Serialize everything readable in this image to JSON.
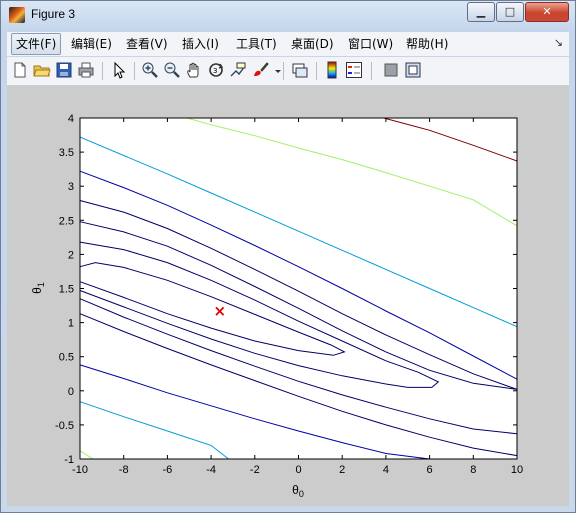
{
  "window": {
    "title": "Figure 3",
    "buttons": {
      "minimize": "▁",
      "maximize": "□",
      "close": "✕"
    }
  },
  "menu": [
    {
      "name": "menu-file",
      "label": "文件(F)",
      "active": true
    },
    {
      "name": "menu-edit",
      "label": "编辑(E)"
    },
    {
      "name": "menu-view",
      "label": "查看(V)"
    },
    {
      "name": "menu-insert",
      "label": "插入(I)"
    },
    {
      "name": "menu-tools",
      "label": "工具(T)"
    },
    {
      "name": "menu-desktop",
      "label": "桌面(D)"
    },
    {
      "name": "menu-window",
      "label": "窗口(W)"
    },
    {
      "name": "menu-help",
      "label": "帮助(H)"
    }
  ],
  "menu_arrow": "↘",
  "toolbar_icons": [
    "new-file-icon",
    "open-folder-icon",
    "save-icon",
    "print-icon",
    "pointer-icon",
    "zoom-in-icon",
    "zoom-out-icon",
    "pan-hand-icon",
    "rotate-3d-icon",
    "data-cursor-icon",
    "brush-icon",
    "link-plot-icon",
    "colorbar-icon",
    "legend-icon",
    "hide-plot-tools-icon",
    "show-plot-tools-icon"
  ],
  "chart_data": {
    "type": "contour",
    "xlabel": "θ0",
    "ylabel": "θ1",
    "xlim": [
      -10,
      10
    ],
    "ylim": [
      -1,
      4
    ],
    "xticks": [
      "-10",
      "-8",
      "-6",
      "-4",
      "-2",
      "0",
      "2",
      "4",
      "6",
      "8",
      "10"
    ],
    "yticks": [
      "4",
      "3.5",
      "3",
      "2.5",
      "2",
      "1.5",
      "1",
      "0.5",
      "0",
      "-0.5",
      "-1"
    ],
    "minimum_marker": {
      "x": -3.6,
      "y": 1.17,
      "symbol": "×",
      "color": "#e00000"
    },
    "contour_levels": [
      {
        "level": 1,
        "color": "#00006a",
        "points": [
          [
            -10,
            1.82
          ],
          [
            -9.3,
            1.88
          ],
          [
            -8,
            1.81
          ],
          [
            -6,
            1.62
          ],
          [
            -4,
            1.38
          ],
          [
            -2,
            1.12
          ],
          [
            0,
            0.86
          ],
          [
            1.5,
            0.67
          ],
          [
            2.1,
            0.57
          ],
          [
            1.6,
            0.52
          ],
          [
            0,
            0.59
          ],
          [
            -2,
            0.73
          ],
          [
            -4,
            0.92
          ],
          [
            -6,
            1.13
          ],
          [
            -8,
            1.37
          ],
          [
            -10,
            1.6
          ]
        ]
      },
      {
        "level": 2,
        "color": "#00006a",
        "points": [
          [
            -10,
            2.18
          ],
          [
            -8,
            2.07
          ],
          [
            -6,
            1.88
          ],
          [
            -4,
            1.62
          ],
          [
            -2,
            1.33
          ],
          [
            0,
            1.02
          ],
          [
            2,
            0.73
          ],
          [
            4,
            0.44
          ],
          [
            5.5,
            0.27
          ],
          [
            6.4,
            0.13
          ],
          [
            6.1,
            0.05
          ],
          [
            5,
            0.05
          ],
          [
            4,
            0.1
          ],
          [
            2,
            0.22
          ],
          [
            0,
            0.37
          ],
          [
            -2,
            0.55
          ],
          [
            -4,
            0.76
          ],
          [
            -6,
            0.99
          ],
          [
            -8,
            1.23
          ],
          [
            -10,
            1.47
          ]
        ]
      },
      {
        "level": 3,
        "color": "#00006a",
        "points": [
          [
            -10,
            2.48
          ],
          [
            -8,
            2.33
          ],
          [
            -6,
            2.12
          ],
          [
            -4,
            1.84
          ],
          [
            -2,
            1.53
          ],
          [
            0,
            1.21
          ],
          [
            2,
            0.88
          ],
          [
            4,
            0.57
          ],
          [
            6,
            0.3
          ],
          [
            8,
            0.11
          ],
          [
            10,
            0.02
          ]
        ]
      },
      {
        "level": 3,
        "color": "#00006a",
        "points": [
          [
            -10,
            1.35
          ],
          [
            -8,
            1.08
          ],
          [
            -6,
            0.83
          ],
          [
            -4,
            0.59
          ],
          [
            -2,
            0.36
          ],
          [
            0,
            0.14
          ],
          [
            2,
            -0.06
          ],
          [
            4,
            -0.24
          ],
          [
            6,
            -0.41
          ],
          [
            8,
            -0.56
          ],
          [
            10,
            -0.63
          ]
        ]
      },
      {
        "level": 4,
        "color": "#00006a",
        "points": [
          [
            -10,
            2.79
          ],
          [
            -8,
            2.62
          ],
          [
            -6,
            2.38
          ],
          [
            -4,
            2.09
          ],
          [
            -2,
            1.78
          ],
          [
            0,
            1.46
          ],
          [
            2,
            1.13
          ],
          [
            4,
            0.82
          ],
          [
            6,
            0.53
          ],
          [
            8,
            0.25
          ],
          [
            10,
            0.02
          ]
        ]
      },
      {
        "level": 4,
        "color": "#00006a",
        "points": [
          [
            -10,
            1.13
          ],
          [
            -8,
            0.87
          ],
          [
            -6,
            0.62
          ],
          [
            -4,
            0.38
          ],
          [
            -2,
            0.15
          ],
          [
            0,
            -0.08
          ],
          [
            2,
            -0.3
          ],
          [
            4,
            -0.5
          ],
          [
            6,
            -0.68
          ],
          [
            8,
            -0.84
          ],
          [
            10,
            -0.95
          ]
        ]
      },
      {
        "level": 5,
        "color": "#0000a6",
        "points": [
          [
            -10,
            3.22
          ],
          [
            -8,
            2.98
          ],
          [
            -6,
            2.72
          ],
          [
            -4,
            2.43
          ],
          [
            -2,
            2.13
          ],
          [
            0,
            1.82
          ],
          [
            2,
            1.5
          ],
          [
            4,
            1.17
          ],
          [
            6,
            0.85
          ],
          [
            8,
            0.51
          ],
          [
            10,
            0.17
          ]
        ]
      },
      {
        "level": 5,
        "color": "#0000a6",
        "points": [
          [
            -10,
            0.38
          ],
          [
            -8,
            0.18
          ],
          [
            -6,
            -0.03
          ],
          [
            -4,
            -0.22
          ],
          [
            -2,
            -0.41
          ],
          [
            0,
            -0.59
          ],
          [
            2,
            -0.76
          ],
          [
            4,
            -0.92
          ],
          [
            6,
            -1.0
          ]
        ]
      },
      {
        "level": 6,
        "color": "#009ed8",
        "points": [
          [
            -10,
            3.72
          ],
          [
            -8,
            3.45
          ],
          [
            -6,
            3.18
          ],
          [
            -4,
            2.9
          ],
          [
            -2,
            2.62
          ],
          [
            0,
            2.34
          ],
          [
            2,
            2.06
          ],
          [
            4,
            1.78
          ],
          [
            6,
            1.5
          ],
          [
            8,
            1.22
          ],
          [
            10,
            0.94
          ]
        ]
      },
      {
        "level": 6,
        "color": "#009ed8",
        "points": [
          [
            -10,
            -0.16
          ],
          [
            -8,
            -0.38
          ],
          [
            -6,
            -0.59
          ],
          [
            -4,
            -0.8
          ],
          [
            -3.2,
            -1.0
          ]
        ]
      },
      {
        "level": 7,
        "color": "#a2f06a",
        "points": [
          [
            -5.1,
            4.0
          ],
          [
            -4,
            3.9
          ],
          [
            -2,
            3.74
          ],
          [
            0,
            3.56
          ],
          [
            2,
            3.39
          ],
          [
            4,
            3.2
          ],
          [
            6,
            3.0
          ],
          [
            8,
            2.8
          ],
          [
            10,
            2.42
          ]
        ]
      },
      {
        "level": 7,
        "color": "#a2f06a",
        "points": [
          [
            -10,
            -0.88
          ],
          [
            -9.4,
            -1.0
          ]
        ]
      },
      {
        "level": 8,
        "color": "#800000",
        "points": [
          [
            3.9,
            4.0
          ],
          [
            6,
            3.82
          ],
          [
            8,
            3.6
          ],
          [
            10,
            3.37
          ]
        ]
      }
    ]
  }
}
